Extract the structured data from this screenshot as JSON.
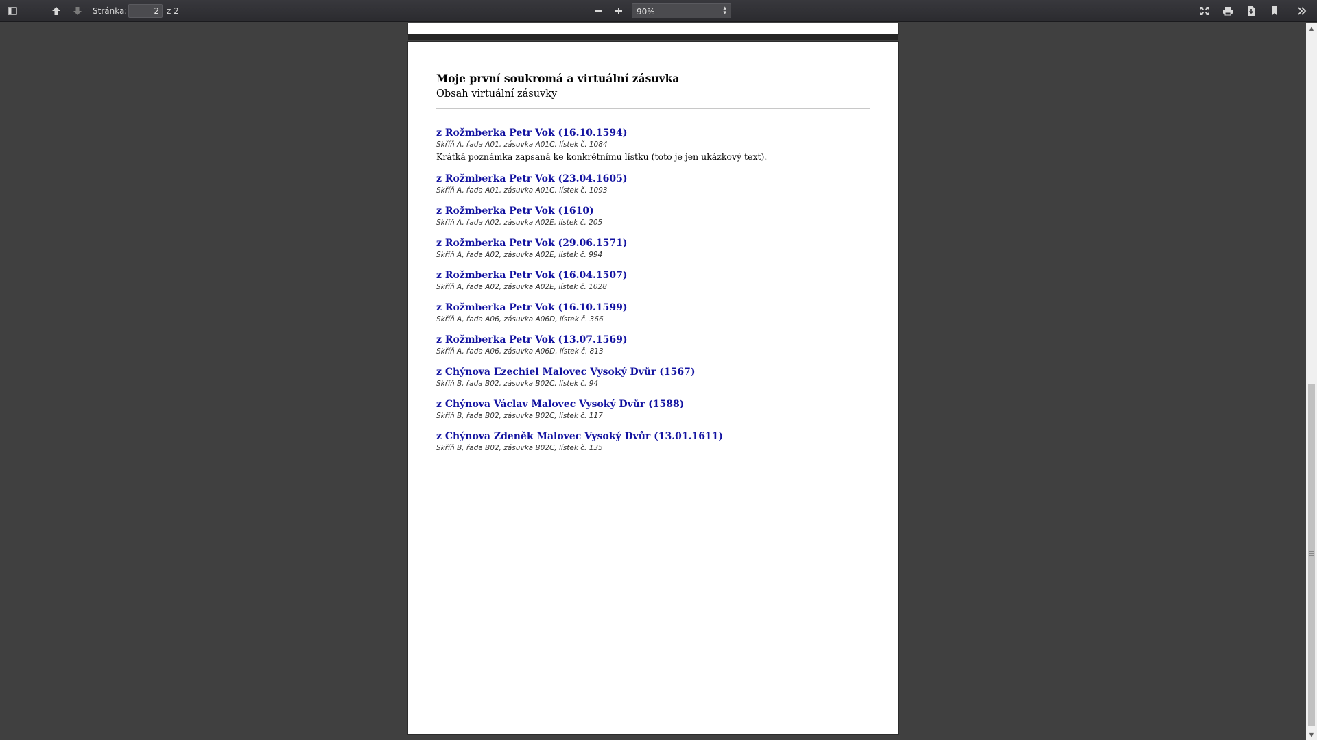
{
  "toolbar": {
    "page_label": "Stránka:",
    "page_current": "2",
    "page_total": "z 2",
    "zoom_value": "90%",
    "icons": {
      "sidebar": "sidebar-toggle-icon",
      "prev": "arrow-up-icon",
      "next": "arrow-down-icon",
      "zoom_out": "minus-icon",
      "zoom_in": "plus-icon",
      "fullscreen": "fullscreen-icon",
      "print": "print-icon",
      "download": "download-icon",
      "bookmark": "bookmark-icon",
      "tools": "double-chevron-right-icon"
    }
  },
  "document": {
    "title": "Moje první soukromá a virtuální zásuvka",
    "subtitle": "Obsah virtuální zásuvky",
    "entries": [
      {
        "title": "z Rožmberka Petr Vok (16.10.1594)",
        "meta": "Skříň A, řada A01, zásuvka A01C, lístek č. 1084",
        "note": "Krátká poznámka zapsaná ke konkrétnímu lístku (toto je jen ukázkový text)."
      },
      {
        "title": "z Rožmberka Petr Vok (23.04.1605)",
        "meta": "Skříň A, řada A01, zásuvka A01C, lístek č. 1093"
      },
      {
        "title": "z Rožmberka Petr Vok (1610)",
        "meta": "Skříň A, řada A02, zásuvka A02E, lístek č. 205"
      },
      {
        "title": "z Rožmberka Petr Vok (29.06.1571)",
        "meta": "Skříň A, řada A02, zásuvka A02E, lístek č. 994"
      },
      {
        "title": "z Rožmberka Petr Vok (16.04.1507)",
        "meta": "Skříň A, řada A02, zásuvka A02E, lístek č. 1028"
      },
      {
        "title": "z Rožmberka Petr Vok (16.10.1599)",
        "meta": "Skříň A, řada A06, zásuvka A06D, lístek č. 366"
      },
      {
        "title": "z Rožmberka Petr Vok (13.07.1569)",
        "meta": "Skříň A, řada A06, zásuvka A06D, lístek č. 813"
      },
      {
        "title": "z Chýnova Ezechiel Malovec Vysoký Dvůr (1567)",
        "meta": "Skříň B, řada B02, zásuvka B02C, lístek č. 94"
      },
      {
        "title": "z Chýnova Václav Malovec Vysoký Dvůr (1588)",
        "meta": "Skříň B, řada B02, zásuvka B02C, lístek č. 117"
      },
      {
        "title": "z Chýnova Zdeněk Malovec Vysoký Dvůr (13.01.1611)",
        "meta": "Skříň B, řada B02, zásuvka B02C, lístek č. 135"
      }
    ]
  },
  "colors": {
    "link": "#1212a0",
    "viewer_background": "#404040",
    "toolbar_background": "#2b2b2f"
  }
}
